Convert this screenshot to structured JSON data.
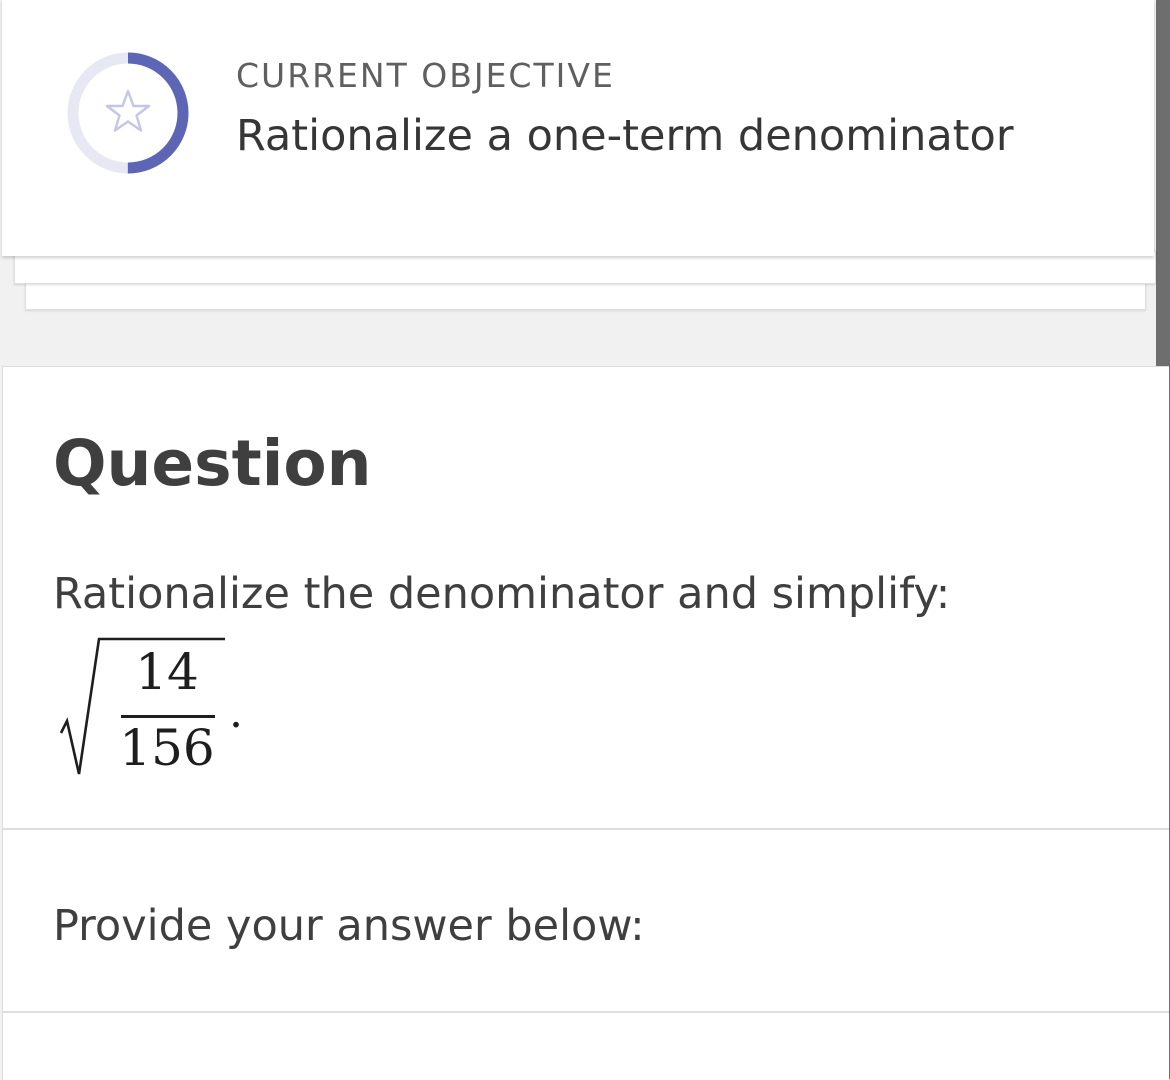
{
  "objective": {
    "kicker": "CURRENT OBJECTIVE",
    "title": "Rationalize a one-term denominator",
    "icon": "star-icon",
    "ring_color": "#5c66b5",
    "ring_track_color": "#e7e8f3",
    "progress_fraction": 0.5
  },
  "question": {
    "heading": "Question",
    "prompt": "Rationalize the denominator and simplify:",
    "expression": {
      "numerator": "14",
      "denominator": "156",
      "trailing": "."
    },
    "answer_prompt": "Provide your answer below:"
  }
}
